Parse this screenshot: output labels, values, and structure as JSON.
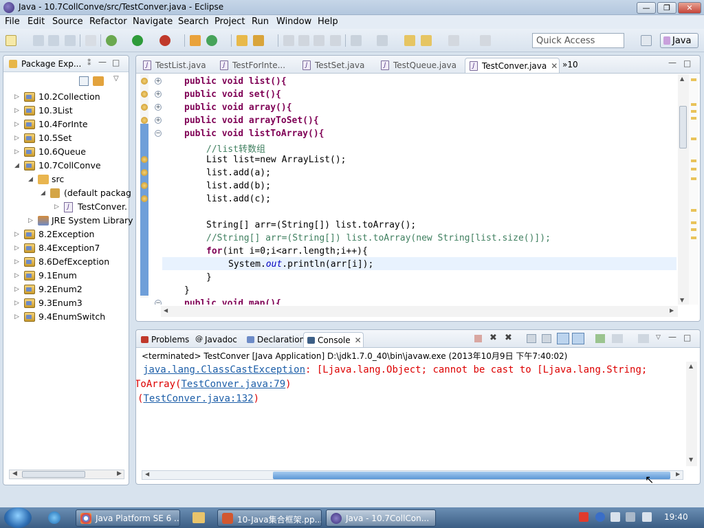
{
  "window": {
    "title": "Java - 10.7CollConve/src/TestConver.java - Eclipse",
    "min": "—",
    "max": "❐",
    "close": "✕"
  },
  "menu": [
    "File",
    "Edit",
    "Source",
    "Refactor",
    "Navigate",
    "Search",
    "Project",
    "Run",
    "Window",
    "Help"
  ],
  "toolbar": {
    "quick_access_placeholder": "Quick Access",
    "perspective": "Java"
  },
  "package_explorer": {
    "title": "Package Exp...",
    "items": [
      {
        "label": "10.2Collection"
      },
      {
        "label": "10.3List"
      },
      {
        "label": "10.4ForInte"
      },
      {
        "label": "10.5Set"
      },
      {
        "label": "10.6Queue"
      },
      {
        "label": "10.7CollConve"
      },
      {
        "label": "src"
      },
      {
        "label": "(default packag"
      },
      {
        "label": "TestConver."
      },
      {
        "label": "JRE System Library"
      },
      {
        "label": "8.2Exception"
      },
      {
        "label": "8.4Exception7"
      },
      {
        "label": "8.6DefException"
      },
      {
        "label": "9.1Enum"
      },
      {
        "label": "9.2Enum2"
      },
      {
        "label": "9.3Enum3"
      },
      {
        "label": "9.4EnumSwitch"
      }
    ]
  },
  "editor": {
    "tabs": [
      {
        "label": "TestList.java"
      },
      {
        "label": "TestForInte..."
      },
      {
        "label": "TestSet.java"
      },
      {
        "label": "TestQueue.java"
      },
      {
        "label": "TestConver.java"
      }
    ],
    "overflow": "»10",
    "code": {
      "l1": "public void list(){",
      "l2": "public void set(){",
      "l3": "public void array(){",
      "l4": "public void arrayToSet(){",
      "l5": "public void listToArray(){",
      "l6": "//list转数组",
      "l7": "List list=new ArrayList();",
      "l8": "list.add(a);",
      "l9": "list.add(b);",
      "l10": "list.add(c);",
      "l11": "String[] arr=(String[]) list.toArray();",
      "l12": "//String[] arr=(String[]) list.toArray(new String[list.size()]);",
      "l13_for": "for",
      "l13_rest": "(int i=0;i<arr.length;i++){",
      "l14_pre": "System.",
      "l14_out": "out",
      "l14_post": ".println(arr[i]);",
      "l15": "}",
      "l16": "}",
      "l17": "public void map(){"
    }
  },
  "console": {
    "tabs": [
      {
        "label": "Problems"
      },
      {
        "label": "Javadoc"
      },
      {
        "label": "Declaration"
      },
      {
        "label": "Console"
      }
    ],
    "status": "<terminated> TestConver [Java Application] D:\\jdk1.7.0_40\\bin\\javaw.exe (2013年10月9日 下午7:40:02)",
    "line1_link": "java.lang.ClassCastException",
    "line1_msg": ": [Ljava.lang.Object; cannot be cast to [Ljava.lang.String;",
    "line2_pre": "ToArray(",
    "line2_link": "TestConver.java:79",
    "line2_post": ")",
    "line3_pre": "(",
    "line3_link": "TestConver.java:132",
    "line3_post": ")"
  },
  "taskbar": {
    "tasks": [
      {
        "label": "Java Platform SE 6 ..."
      },
      {
        "label": "10-Java集合框架.pp..."
      },
      {
        "label": "Java - 10.7CollCon..."
      }
    ],
    "clock": "19:40"
  }
}
